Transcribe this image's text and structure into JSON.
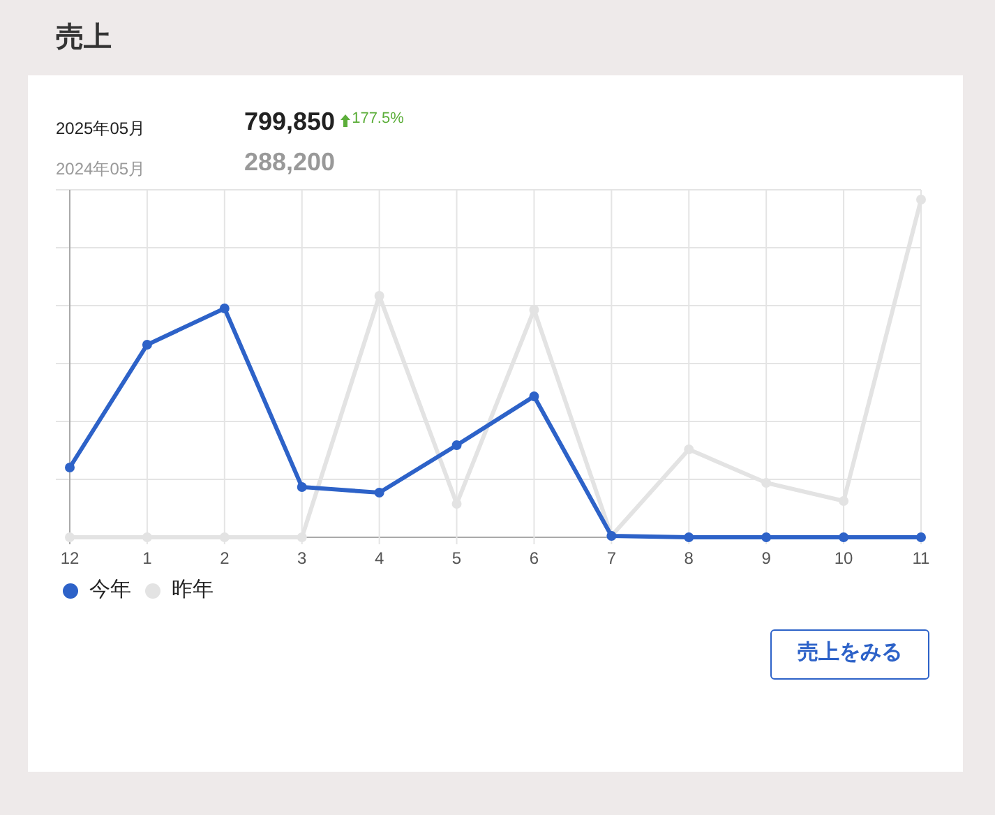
{
  "title": "売上",
  "summary": [
    {
      "period": "2025年05月",
      "amount": "799,850",
      "change": "177.5%",
      "current": true
    },
    {
      "period": "2024年05月",
      "amount": "288,200",
      "current": false
    }
  ],
  "chart": {
    "categories": [
      "12",
      "1",
      "2",
      "3",
      "4",
      "5",
      "6",
      "7",
      "8",
      "9",
      "10",
      "11"
    ],
    "legend": [
      {
        "label": "今年",
        "color": "#2d62c8"
      },
      {
        "label": "昨年",
        "color": "#e3e3e3"
      }
    ]
  },
  "button": "売上をみる"
}
